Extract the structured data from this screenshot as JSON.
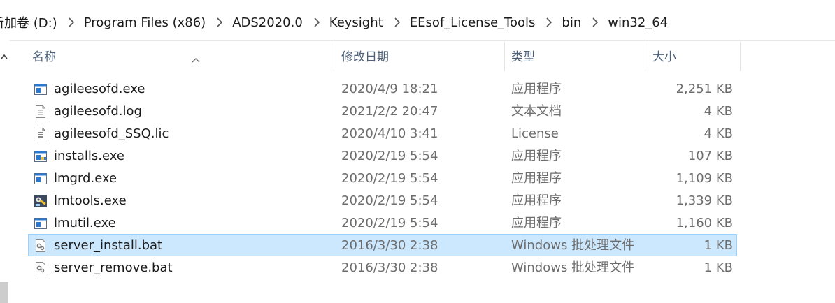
{
  "breadcrumb": {
    "items": [
      {
        "label": "新加卷 (D:)"
      },
      {
        "label": "Program Files (x86)"
      },
      {
        "label": "ADS2020.0"
      },
      {
        "label": "Keysight"
      },
      {
        "label": "EEsof_License_Tools"
      },
      {
        "label": "bin"
      },
      {
        "label": "win32_64"
      }
    ]
  },
  "columns": {
    "name": "名称",
    "date": "修改日期",
    "type": "类型",
    "size": "大小"
  },
  "files": [
    {
      "name": "agileesofd.exe",
      "date": "2020/4/9 18:21",
      "type": "应用程序",
      "size": "2,251 KB",
      "icon": "exe-icon",
      "selected": false
    },
    {
      "name": "agileesofd.log",
      "date": "2021/2/2 20:47",
      "type": "文本文档",
      "size": "4 KB",
      "icon": "text-file-icon",
      "selected": false
    },
    {
      "name": "agileesofd_SSQ.lic",
      "date": "2020/4/10 3:41",
      "type": "License",
      "size": "4 KB",
      "icon": "license-file-icon",
      "selected": false
    },
    {
      "name": "installs.exe",
      "date": "2020/2/19 5:54",
      "type": "应用程序",
      "size": "107 KB",
      "icon": "installer-exe-icon",
      "selected": false
    },
    {
      "name": "lmgrd.exe",
      "date": "2020/2/19 5:54",
      "type": "应用程序",
      "size": "1,109 KB",
      "icon": "exe-icon",
      "selected": false
    },
    {
      "name": "lmtools.exe",
      "date": "2020/2/19 5:54",
      "type": "应用程序",
      "size": "1,339 KB",
      "icon": "tools-exe-icon",
      "selected": false
    },
    {
      "name": "lmutil.exe",
      "date": "2020/2/19 5:54",
      "type": "应用程序",
      "size": "1,160 KB",
      "icon": "exe-icon",
      "selected": false
    },
    {
      "name": "server_install.bat",
      "date": "2016/3/30 2:38",
      "type": "Windows 批处理文件",
      "size": "1 KB",
      "icon": "batch-file-icon",
      "selected": true
    },
    {
      "name": "server_remove.bat",
      "date": "2016/3/30 2:38",
      "type": "Windows 批处理文件",
      "size": "1 KB",
      "icon": "batch-file-icon",
      "selected": false
    }
  ],
  "colors": {
    "selection_bg": "#cce8ff",
    "selection_border": "#99d1ff",
    "header_text": "#4c607a",
    "secondary_text": "#6d6d6d"
  }
}
